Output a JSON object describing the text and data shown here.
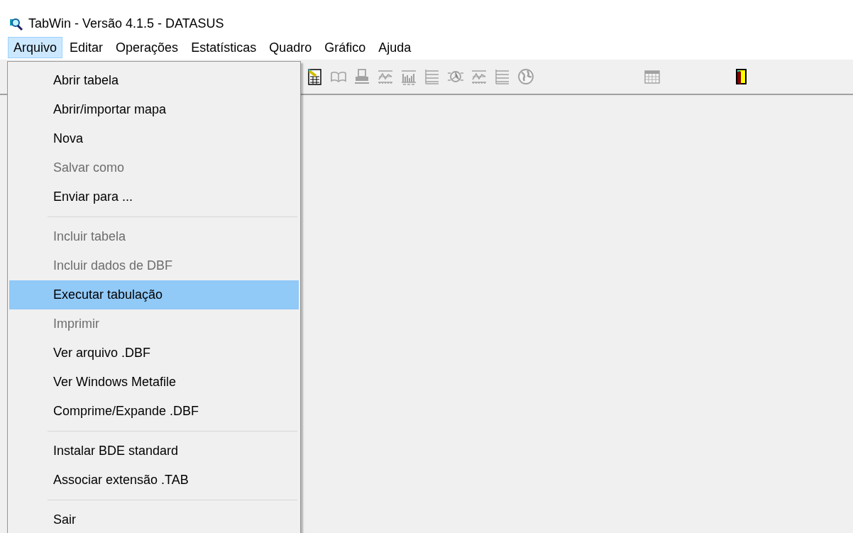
{
  "window": {
    "title": "TabWin  -  Versão 4.1.5  -  DATASUS"
  },
  "menubar": [
    {
      "label": "Arquivo",
      "selected": true
    },
    {
      "label": "Editar",
      "selected": false
    },
    {
      "label": "Operações",
      "selected": false
    },
    {
      "label": "Estatísticas",
      "selected": false
    },
    {
      "label": "Quadro",
      "selected": false
    },
    {
      "label": "Gráfico",
      "selected": false
    },
    {
      "label": "Ajuda",
      "selected": false
    }
  ],
  "toolbar": [
    {
      "kind": "tabulate",
      "disabled": false
    },
    {
      "kind": "book",
      "disabled": true
    },
    {
      "kind": "printer",
      "disabled": true
    },
    {
      "kind": "line-chart",
      "disabled": true
    },
    {
      "kind": "bar-chart",
      "disabled": true
    },
    {
      "kind": "list-chart",
      "disabled": true
    },
    {
      "kind": "pie-chart",
      "disabled": true
    },
    {
      "kind": "line-chart",
      "disabled": true
    },
    {
      "kind": "list-chart",
      "disabled": true
    },
    {
      "kind": "globe",
      "disabled": true
    },
    {
      "kind": "spacer"
    },
    {
      "kind": "calendar",
      "disabled": true
    },
    {
      "kind": "spacer"
    },
    {
      "kind": "exit",
      "disabled": false
    }
  ],
  "menu": [
    {
      "kind": "item",
      "label": "Abrir tabela",
      "disabled": false,
      "selected": false
    },
    {
      "kind": "item",
      "label": "Abrir/importar mapa",
      "disabled": false,
      "selected": false
    },
    {
      "kind": "item",
      "label": "Nova",
      "disabled": false,
      "selected": false
    },
    {
      "kind": "item",
      "label": "Salvar como",
      "disabled": true,
      "selected": false
    },
    {
      "kind": "item",
      "label": "Enviar para ...",
      "disabled": false,
      "selected": false
    },
    {
      "kind": "separator"
    },
    {
      "kind": "item",
      "label": "Incluir tabela",
      "disabled": true,
      "selected": false
    },
    {
      "kind": "item",
      "label": "Incluir dados de DBF",
      "disabled": true,
      "selected": false
    },
    {
      "kind": "item",
      "label": "Executar tabulação",
      "disabled": false,
      "selected": true
    },
    {
      "kind": "item",
      "label": "Imprimir",
      "disabled": true,
      "selected": false
    },
    {
      "kind": "item",
      "label": "Ver arquivo .DBF",
      "disabled": false,
      "selected": false
    },
    {
      "kind": "item",
      "label": "Ver Windows Metafile",
      "disabled": false,
      "selected": false
    },
    {
      "kind": "item",
      "label": "Comprime/Expande .DBF",
      "disabled": false,
      "selected": false
    },
    {
      "kind": "separator"
    },
    {
      "kind": "item",
      "label": "Instalar BDE standard",
      "disabled": false,
      "selected": false
    },
    {
      "kind": "item",
      "label": "Associar extensão .TAB",
      "disabled": false,
      "selected": false
    },
    {
      "kind": "separator"
    },
    {
      "kind": "item",
      "label": "Sair",
      "disabled": false,
      "selected": false
    }
  ]
}
